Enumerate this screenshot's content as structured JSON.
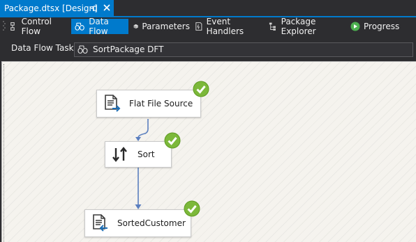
{
  "document_tab": {
    "title": "Package.dtsx [Design]"
  },
  "toolbar": {
    "items": [
      {
        "label": "Control Flow"
      },
      {
        "label": "Data Flow"
      },
      {
        "label": "Parameters"
      },
      {
        "label": "Event Handlers"
      },
      {
        "label": "Package Explorer"
      },
      {
        "label": "Progress"
      }
    ]
  },
  "task_row": {
    "label": "Data Flow Task:",
    "value": "SortPackage DFT"
  },
  "components": [
    {
      "name": "Flat File Source"
    },
    {
      "name": "Sort"
    },
    {
      "name": "SortedCustomer"
    }
  ],
  "colors": {
    "accent": "#007acc",
    "success": "#7cb83a",
    "path": "#5b7fbf"
  }
}
